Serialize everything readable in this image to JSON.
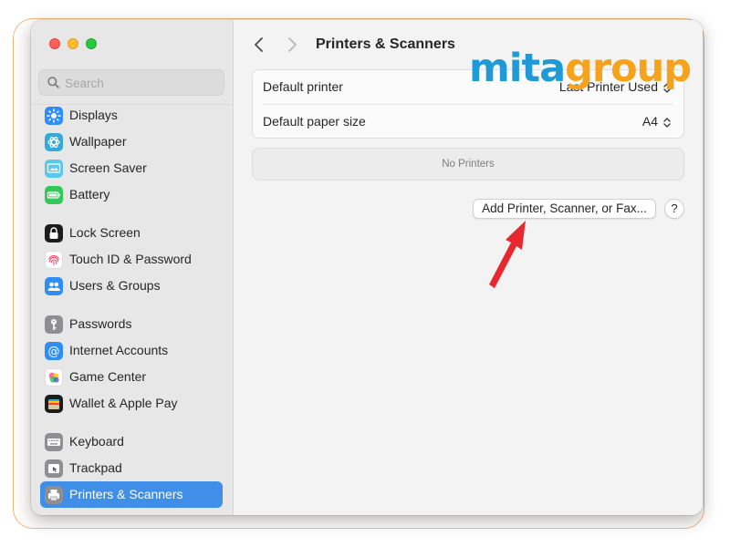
{
  "window": {
    "title": "Printers & Scanners"
  },
  "search": {
    "placeholder": "Search"
  },
  "sidebar": {
    "items": [
      {
        "label": "Displays",
        "icon": "displays-icon"
      },
      {
        "label": "Wallpaper",
        "icon": "wallpaper-icon"
      },
      {
        "label": "Screen Saver",
        "icon": "screen-saver-icon"
      },
      {
        "label": "Battery",
        "icon": "battery-icon"
      },
      {
        "label": "Lock Screen",
        "icon": "lock-icon"
      },
      {
        "label": "Touch ID & Password",
        "icon": "fingerprint-icon"
      },
      {
        "label": "Users & Groups",
        "icon": "users-icon"
      },
      {
        "label": "Passwords",
        "icon": "key-icon"
      },
      {
        "label": "Internet Accounts",
        "icon": "at-icon"
      },
      {
        "label": "Game Center",
        "icon": "game-center-icon"
      },
      {
        "label": "Wallet & Apple Pay",
        "icon": "wallet-icon"
      },
      {
        "label": "Keyboard",
        "icon": "keyboard-icon"
      },
      {
        "label": "Trackpad",
        "icon": "trackpad-icon"
      },
      {
        "label": "Printers & Scanners",
        "icon": "printer-icon",
        "selected": true
      }
    ]
  },
  "settings": {
    "default_printer_label": "Default printer",
    "default_printer_value": "Last Printer Used",
    "paper_size_label": "Default paper size",
    "paper_size_value": "A4"
  },
  "printers_list": {
    "empty_text": "No Printers"
  },
  "actions": {
    "add_label": "Add Printer, Scanner, or Fax...",
    "help_label": "?"
  },
  "watermark": {
    "part1": "mita",
    "part2": "group"
  },
  "colors": {
    "accent": "#3f8fe8",
    "annotation_arrow": "#e8272f",
    "frame_border": "#f0b87c",
    "logo_blue": "#1f9ad6",
    "logo_orange": "#f7a21b"
  }
}
